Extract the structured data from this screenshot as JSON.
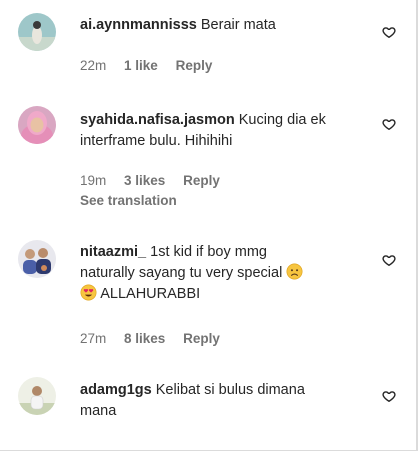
{
  "comments": [
    {
      "username": "ai.aynnmannisss",
      "text": "Berair mata",
      "time": "22m",
      "likes": "1 like",
      "reply": "Reply",
      "avatar_icon": "avatar-girl-teal-background"
    },
    {
      "username": "syahida.nafisa.jasmon",
      "text_line1": "Kucing dia ek",
      "text_line2": "interframe bulu. Hihihihi",
      "time": "19m",
      "likes": "3 likes",
      "reply": "Reply",
      "see_translation": "See translation",
      "avatar_icon": "avatar-woman-pink-hijab"
    },
    {
      "username": "nitaazmi_",
      "text_line1": "1st kid if boy mmg",
      "text_line2": "naturally sayang tu very special",
      "text_line3": "ALLAHURABBI",
      "emoji1": "sad-face-emoji",
      "emoji2": "heart-eyes-emoji",
      "time": "27m",
      "likes": "8 likes",
      "reply": "Reply",
      "avatar_icon": "avatar-group-photo"
    },
    {
      "username": "adamg1gs",
      "text_line1": "Kelibat si bulus dimana",
      "text_line2": "mana",
      "avatar_icon": "avatar-person-outdoors"
    }
  ],
  "icons": {
    "like": "heart-outline-icon"
  },
  "colors": {
    "text": "#262626",
    "secondary": "#737373",
    "border": "#dbdbdb"
  }
}
